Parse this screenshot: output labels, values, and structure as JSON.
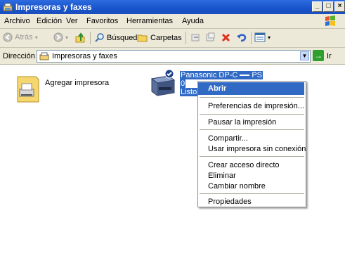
{
  "window": {
    "title": "Impresoras y faxes",
    "buttons": [
      "_",
      "□",
      "×"
    ]
  },
  "menubar": {
    "items": [
      {
        "label": "Archivo"
      },
      {
        "label": "Edición"
      },
      {
        "label": "Ver"
      },
      {
        "label": "Favoritos"
      },
      {
        "label": "Herramientas"
      },
      {
        "label": "Ayuda"
      }
    ]
  },
  "toolbar": {
    "back_label": "Atrás",
    "search_label": "Búsqueda",
    "folders_label": "Carpetas"
  },
  "address": {
    "label": "Dirección",
    "value": "Impresoras y faxes",
    "go_label": "Ir"
  },
  "content": {
    "add_printer_label": "Agregar impresora",
    "printer": {
      "name": "Panasonic DP-C",
      "name_suffix": "PS",
      "documents": "0",
      "status": "Listo"
    }
  },
  "context_menu": {
    "items": [
      {
        "label": "Abrir",
        "selected": true
      },
      {
        "label": "Preferencias de impresión..."
      },
      {
        "label": "Pausar la impresión"
      },
      {
        "label": "Compartir..."
      },
      {
        "label": "Usar impresora sin conexión"
      },
      {
        "label": "Crear acceso directo"
      },
      {
        "label": "Eliminar"
      },
      {
        "label": "Cambiar nombre"
      },
      {
        "label": "Propiedades"
      }
    ]
  },
  "colors": {
    "titlebar": "#1853c9",
    "selection": "#316ac5",
    "chrome": "#ece9d8"
  }
}
